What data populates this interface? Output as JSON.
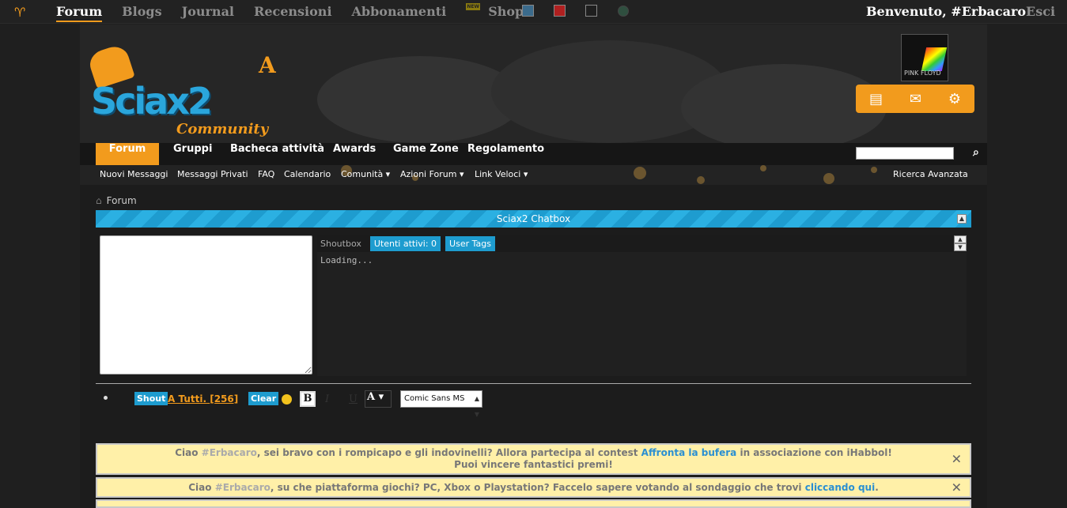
{
  "topbar": {
    "logo_icon": "bunny-logo-icon",
    "nav": [
      {
        "label": "Forum",
        "active": true
      },
      {
        "label": "Blogs"
      },
      {
        "label": "Journal"
      },
      {
        "label": "Recensioni"
      },
      {
        "label": "Abbonamenti"
      },
      {
        "label": "Shop!",
        "badge": "NEW"
      }
    ],
    "style_swatches": [
      "#3b6b8c",
      "#b02020",
      "#1f1f1f"
    ],
    "welcome": "Benvenuto, #Erbacaro",
    "logout": "Esci"
  },
  "header": {
    "brand_main": "Sciax2",
    "brand_badge": "A",
    "brand_sub": "Community",
    "avatar_text": "PINK FLOYD",
    "user_tools": [
      "profile-card-icon",
      "envelope-icon",
      "gears-icon"
    ]
  },
  "navbar": {
    "items": [
      "Forum",
      "Gruppi",
      "Bacheca attività",
      "Awards",
      "Game Zone",
      "Regolamento"
    ],
    "search_placeholder": ""
  },
  "subnav": {
    "items": [
      "Nuovi Messaggi",
      "Messaggi Privati",
      "FAQ",
      "Calendario",
      "Comunità ▾",
      "Azioni Forum ▾",
      "Link Veloci ▾"
    ],
    "advanced_search": "Ricerca Avanzata"
  },
  "breadcrumb": {
    "label": "Forum"
  },
  "chatbox": {
    "title": "Sciax2 Chatbox",
    "tab_label": "Shoutbox",
    "active_users": "Utenti attivi: 0",
    "user_tags": "User Tags",
    "loading": "Loading...",
    "shout_button": "Shout",
    "target": "A Tutti.",
    "count": "[256]",
    "clear_button": "Clear",
    "font_value": "Comic Sans MS"
  },
  "notices": [
    {
      "pre": "Ciao ",
      "user": "#Erbacaro",
      "mid": ", sei bravo con i rompicapo e gli indovinelli? Allora partecipa al contest ",
      "link": "Affronta la bufera",
      "post": " in associazione con iHabbol!",
      "line2": "Puoi vincere fantastici premi!"
    },
    {
      "pre": "Ciao ",
      "user": "#Erbacaro",
      "mid": ", su che piattaforma giochi? PC, Xbox o Playstation? Faccelo sapere votando al sondaggio che trovi ",
      "link": "cliccando qui",
      "post": "."
    }
  ]
}
